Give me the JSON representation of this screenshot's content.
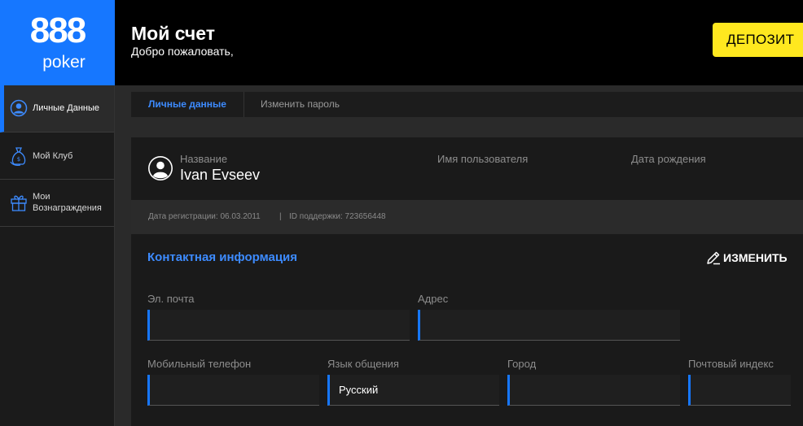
{
  "brand": {
    "digits": "888",
    "word": "poker",
    "color": "#1677ff"
  },
  "header": {
    "title": "Мой счет",
    "subtitle": "Добро пожаловать,",
    "deposit_label": "ДЕПОЗИТ"
  },
  "sidebar": {
    "items": [
      {
        "label": "Личные Данные",
        "icon": "user-circle-icon"
      },
      {
        "label": "Мой Клуб",
        "icon": "money-bag-icon"
      },
      {
        "label_line1": "Мои",
        "label_line2": "Вознаграждения",
        "icon": "gift-icon"
      }
    ]
  },
  "tabs": [
    {
      "label": "Личные данные"
    },
    {
      "label": "Изменить пароль"
    }
  ],
  "profile": {
    "name_label": "Название",
    "name_value": "Ivan Evseev",
    "username_label": "Имя пользователя",
    "birthdate_label": "Дата рождения"
  },
  "registration": {
    "reg_date": "Дата регистрации: 06.03.2011",
    "separator": "|",
    "support_id": "ID поддержки: 723656448"
  },
  "contact": {
    "title": "Контактная информация",
    "edit_label": "ИЗМЕНИТЬ",
    "fields": {
      "email": {
        "label": "Эл. почта",
        "value": ""
      },
      "address": {
        "label": "Адрес",
        "value": ""
      },
      "mobile": {
        "label": "Мобильный телефон",
        "value": ""
      },
      "language": {
        "label": "Язык общения",
        "value": "Русский"
      },
      "city": {
        "label": "Город",
        "value": ""
      },
      "zip": {
        "label": "Почтовый индекс",
        "value": ""
      }
    }
  },
  "colors": {
    "accent": "#1677ff",
    "deposit": "#ffe81f"
  }
}
